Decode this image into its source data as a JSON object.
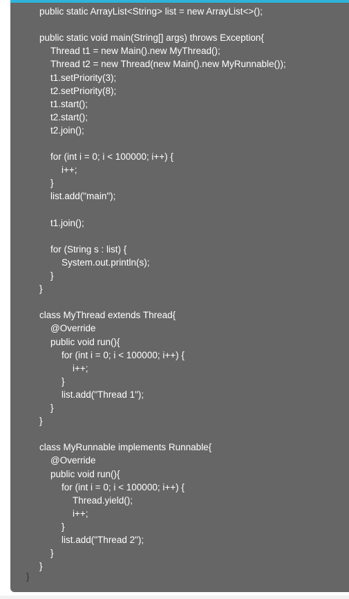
{
  "code_lines": [
    "public static ArrayList<String> list = new ArrayList<>();",
    "",
    "public static void main(String[] args) throws Exception{",
    "    Thread t1 = new Main().new MyThread();",
    "    Thread t2 = new Thread(new Main().new MyRunnable());",
    "    t1.setPriority(3);",
    "    t2.setPriority(8);",
    "    t1.start();",
    "    t2.start();",
    "    t2.join();",
    "",
    "    for (int i = 0; i < 100000; i++) {",
    "        i++;",
    "    }",
    "    list.add(\"main\");",
    "",
    "    t1.join();",
    "",
    "    for (String s : list) {",
    "        System.out.println(s);",
    "    }",
    "}",
    "",
    "class MyThread extends Thread{",
    "    @Override",
    "    public void run(){",
    "        for (int i = 0; i < 100000; i++) {",
    "            i++;",
    "        }",
    "        list.add(\"Thread 1\");",
    "    }",
    "}",
    "",
    "class MyRunnable implements Runnable{",
    "    @Override",
    "    public void run(){",
    "        for (int i = 0; i < 100000; i++) {",
    "            Thread.yield();",
    "            i++;",
    "        }",
    "        list.add(\"Thread 2\");",
    "    }",
    "}"
  ],
  "closing_brace": "}"
}
